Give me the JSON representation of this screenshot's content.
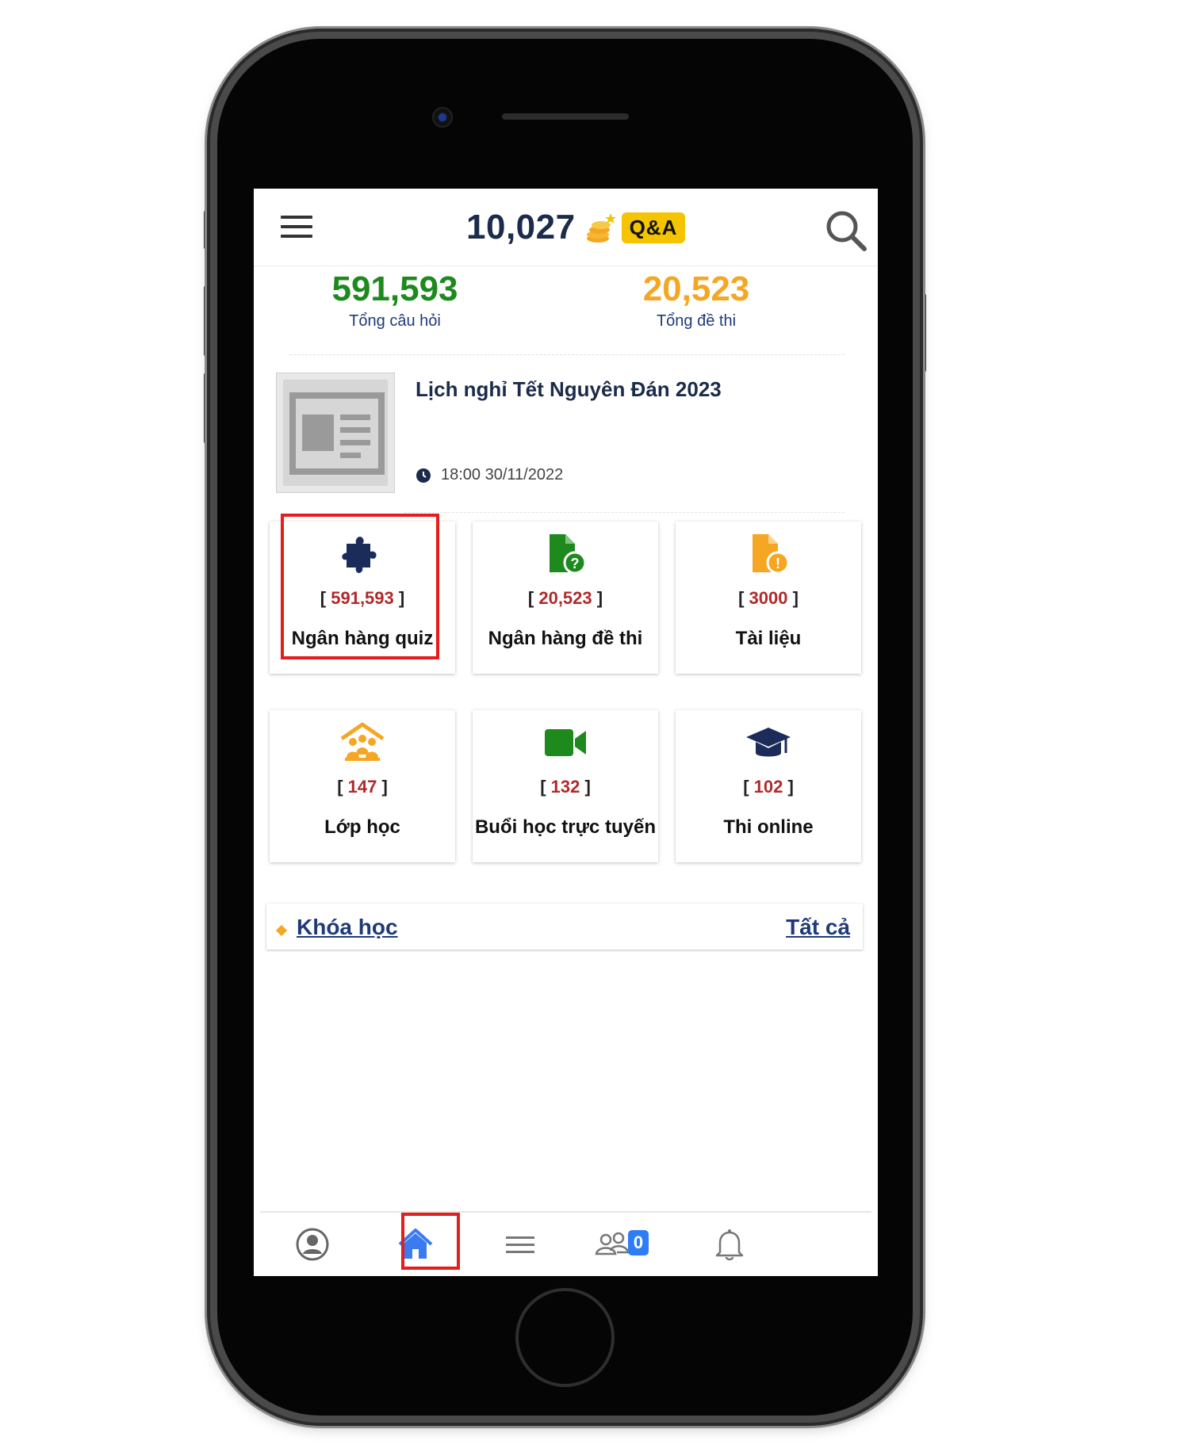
{
  "header": {
    "coins": "10,027",
    "qa_badge": "Q&A"
  },
  "stats": [
    {
      "value": "591,593",
      "label": "Tổng câu hỏi",
      "color": "#1e8a1e"
    },
    {
      "value": "20,523",
      "label": "Tổng đề thi",
      "color": "#f5a623"
    }
  ],
  "news": {
    "title": "Lịch nghỉ Tết Nguyên Đán 2023",
    "time": "18:00 30/11/2022"
  },
  "tiles": [
    {
      "count": "591,593",
      "label": "Ngân hàng quiz",
      "icon": "puzzle-icon",
      "color": "#1b2b5a"
    },
    {
      "count": "20,523",
      "label": "Ngân hàng đề thi",
      "icon": "file-question-icon",
      "color": "#1e8a1e"
    },
    {
      "count": "3000",
      "label": "Tài liệu",
      "icon": "file-alert-icon",
      "color": "#f5a623"
    },
    {
      "count": "147",
      "label": "Lớp học",
      "icon": "classroom-icon",
      "color": "#f5a623"
    },
    {
      "count": "132",
      "label": "Buổi học trực tuyến",
      "icon": "video-icon",
      "color": "#1e8a1e"
    },
    {
      "count": "102",
      "label": "Thi online",
      "icon": "graduation-cap-icon",
      "color": "#1b2b5a"
    }
  ],
  "section": {
    "title": "Khóa học",
    "link": "Tất cả"
  },
  "bottom_nav": {
    "items": [
      "profile-icon",
      "home-icon",
      "menu-icon",
      "group-icon",
      "bell-icon"
    ],
    "group_badge": "0",
    "active": "home-icon",
    "active_color": "#3a7bf0"
  },
  "highlight_color": "#e41d1d"
}
